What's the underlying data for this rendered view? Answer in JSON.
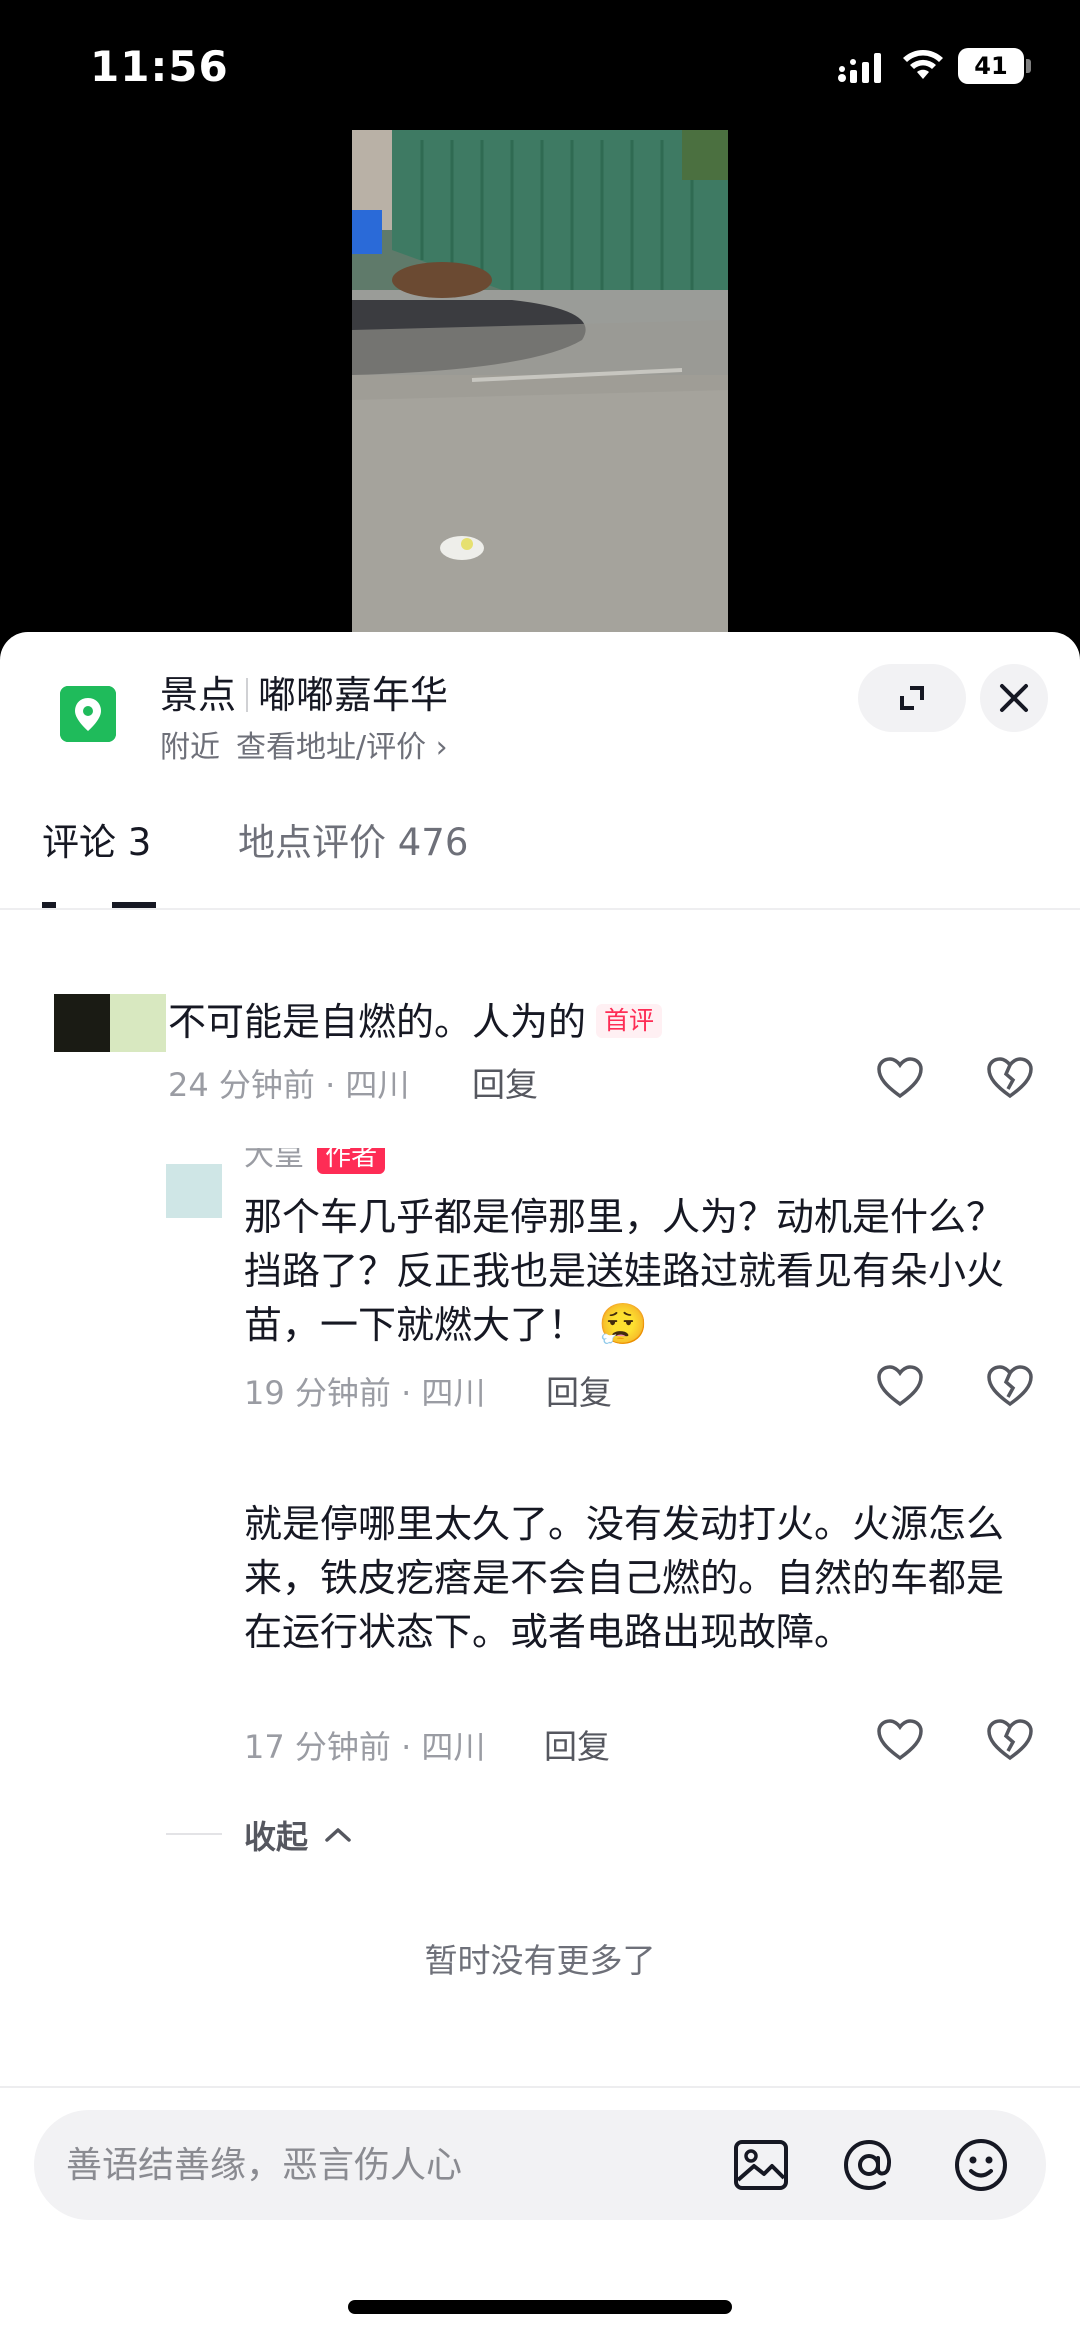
{
  "status_bar": {
    "time": "11:56",
    "battery": "41"
  },
  "location": {
    "category": "景点",
    "name": "嘟嘟嘉年华",
    "nearby": "附近",
    "view_address": "查看地址/评价 ›"
  },
  "tabs": [
    {
      "label": "评论 3",
      "active": true
    },
    {
      "label": "地点评价 476",
      "active": false
    }
  ],
  "comments": [
    {
      "text": "不可能是自燃的。人为的",
      "badge": "首评",
      "time": "24 分钟前 · 四川",
      "reply": "回复",
      "replies": [
        {
          "author_partial": "大皇",
          "author_badge": "作者",
          "text": "那个车几乎都是停那里，人为？动机是什么？挡路了？反正我也是送娃路过就看见有朵小火苗，一下就燃大了！",
          "emoji": "😮‍💨",
          "time": "19 分钟前 · 四川",
          "reply": "回复"
        },
        {
          "text": "就是停哪里太久了。没有发动打火。火源怎么来，铁皮疙瘩是不会自己燃的。自然的车都是在运行状态下。或者电路出现故障。",
          "time": "17 分钟前 · 四川",
          "reply": "回复"
        }
      ]
    }
  ],
  "collapse_label": "收起",
  "no_more": "暂时没有更多了",
  "input": {
    "placeholder": "善语结善缘，恶言伤人心"
  },
  "icons": {
    "location": "map-pin-icon",
    "expand": "expand-icon",
    "close": "close-icon",
    "like": "heart-icon",
    "dislike": "broken-heart-icon",
    "image": "image-icon",
    "mention": "at-icon",
    "emoji": "emoji-icon"
  },
  "colors": {
    "accent": "#fe2c55",
    "location_green": "#1fbb5b"
  }
}
